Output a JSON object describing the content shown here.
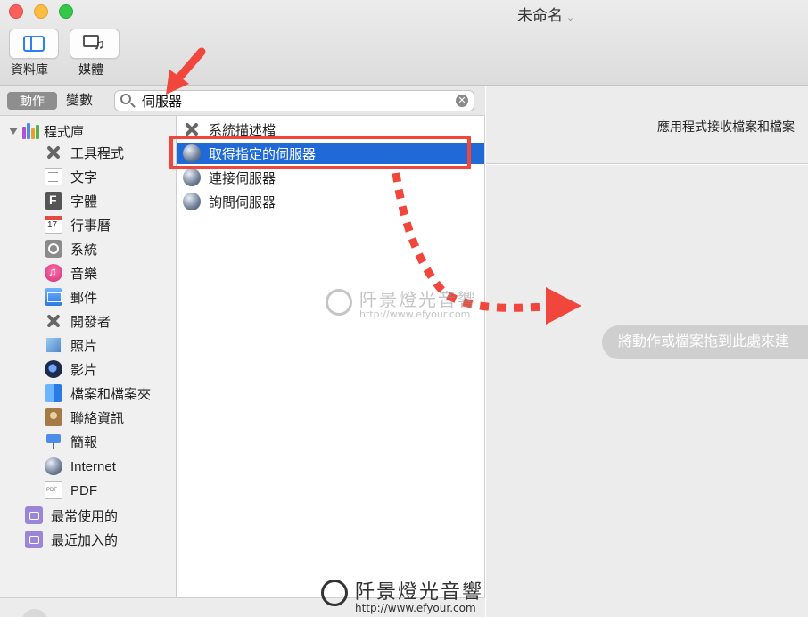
{
  "window": {
    "title": "未命名",
    "title_chevron": "⌄"
  },
  "toolbar": {
    "library_label": "資料庫",
    "media_label": "媒體"
  },
  "filter": {
    "actions_tab": "動作",
    "variables_tab": "變數",
    "search_value": "伺服器",
    "clear_glyph": "✕"
  },
  "library": {
    "root_label": "程式庫",
    "items": [
      {
        "label": "工具程式",
        "icon": "tools-icon"
      },
      {
        "label": "文字",
        "icon": "text-icon"
      },
      {
        "label": "字體",
        "icon": "font-icon"
      },
      {
        "label": "行事曆",
        "icon": "calendar-icon"
      },
      {
        "label": "系統",
        "icon": "system-icon"
      },
      {
        "label": "音樂",
        "icon": "music-icon"
      },
      {
        "label": "郵件",
        "icon": "mail-icon"
      },
      {
        "label": "開發者",
        "icon": "developer-icon"
      },
      {
        "label": "照片",
        "icon": "photos-icon"
      },
      {
        "label": "影片",
        "icon": "movies-icon"
      },
      {
        "label": "檔案和檔案夾",
        "icon": "finder-icon"
      },
      {
        "label": "聯絡資訊",
        "icon": "contacts-icon"
      },
      {
        "label": "簡報",
        "icon": "presentation-icon"
      },
      {
        "label": "Internet",
        "icon": "globe-icon"
      },
      {
        "label": "PDF",
        "icon": "pdf-icon"
      }
    ],
    "smart_folders": [
      {
        "label": "最常使用的",
        "icon": "folder-icon"
      },
      {
        "label": "最近加入的",
        "icon": "folder-icon"
      }
    ]
  },
  "actions": {
    "items": [
      {
        "label": "系統描述檔",
        "icon": "tools-icon"
      },
      {
        "label": "取得指定的伺服器",
        "icon": "globe-icon",
        "selected": true
      },
      {
        "label": "連接伺服器",
        "icon": "globe-icon"
      },
      {
        "label": "詢問伺服器",
        "icon": "globe-icon"
      }
    ]
  },
  "workflow": {
    "receives_text": "應用程式接收檔案和檔案",
    "drop_hint": "將動作或檔案拖到此處來建"
  },
  "watermark": {
    "name": "阡景燈光音響",
    "url": "http://www.efyour.com"
  },
  "colors": {
    "selection": "#1f6ad6",
    "annotation_red": "#f0463b"
  }
}
